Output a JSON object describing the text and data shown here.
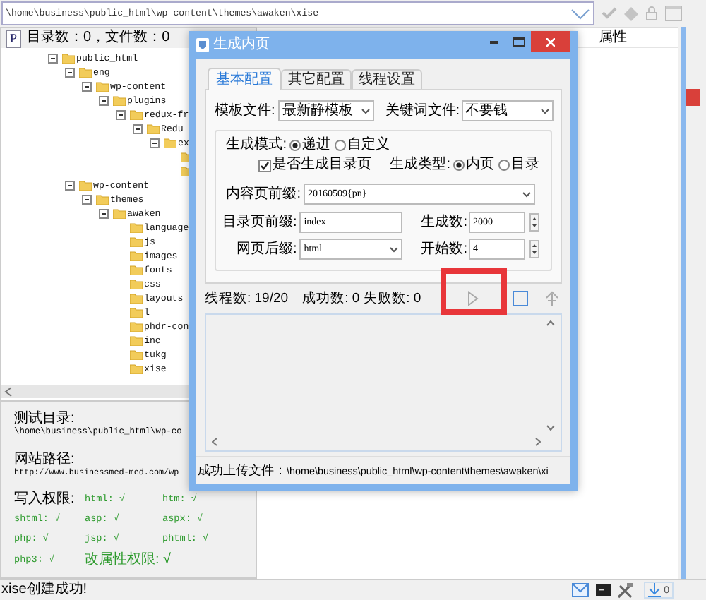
{
  "path_bar": {
    "value": "\\home\\business\\public_html\\wp-content\\themes\\awaken\\xise"
  },
  "tree_header": {
    "badge": "P",
    "label": "目录数：0，文件数：0"
  },
  "tree": [
    {
      "label": "public_html",
      "expanded": true,
      "children": [
        {
          "label": "eng",
          "expanded": true,
          "children": [
            {
              "label": "wp-content",
              "expanded": true,
              "children": [
                {
                  "label": "plugins",
                  "expanded": true,
                  "children": [
                    {
                      "label": "redux-fr",
                      "expanded": true,
                      "children": [
                        {
                          "label": "Redu",
                          "expanded": true,
                          "children": [
                            {
                              "label": "ex",
                              "expanded": true,
                              "children": [
                                {
                                  "kind": "folder"
                                },
                                {
                                  "kind": "folder"
                                }
                              ]
                            }
                          ]
                        }
                      ]
                    }
                  ]
                }
              ]
            }
          ]
        },
        {
          "label": "wp-content",
          "expanded": true,
          "children": [
            {
              "label": "themes",
              "expanded": true,
              "children": [
                {
                  "label": "awaken",
                  "expanded": true,
                  "children": [
                    {
                      "label": "language"
                    },
                    {
                      "label": "js"
                    },
                    {
                      "label": "images"
                    },
                    {
                      "label": "fonts"
                    },
                    {
                      "label": "css"
                    },
                    {
                      "label": "layouts"
                    },
                    {
                      "label": "l"
                    },
                    {
                      "label": "phdr-con"
                    },
                    {
                      "label": "inc"
                    },
                    {
                      "label": "tukg"
                    },
                    {
                      "label": "xise"
                    }
                  ]
                }
              ]
            }
          ]
        }
      ]
    }
  ],
  "column_headers": [
    {
      "label": "属性"
    }
  ],
  "info": {
    "test_dir_label": "测试目录:",
    "test_dir": "\\home\\business\\public_html\\wp-co",
    "site_path_label": "网站路径:",
    "site_path": "http://www.businessmed-med.com/wp",
    "write_label": "写入权限:",
    "permissions": [
      {
        "label": "html: √"
      },
      {
        "label": "htm: √"
      },
      {
        "label": "shtml: √"
      },
      {
        "label": "asp: √"
      },
      {
        "label": "aspx: √"
      },
      {
        "label": "php: √"
      },
      {
        "label": "jsp: √"
      },
      {
        "label": "phtml: √"
      },
      {
        "label": "php3: √"
      },
      {
        "label": "改属性权限: √"
      }
    ]
  },
  "dialog": {
    "title": "生成内页",
    "tabs": [
      {
        "label": "基本配置",
        "selected": true
      },
      {
        "label": "其它配置",
        "selected": false
      },
      {
        "label": "线程设置",
        "selected": false
      }
    ],
    "template": {
      "label": "模板文件:",
      "value": "最新静模板"
    },
    "keyword": {
      "label": "关键词文件:",
      "value": "不要钱"
    },
    "mode": {
      "label": "生成模式:",
      "options": [
        {
          "label": "递进",
          "selected": true
        },
        {
          "label": "自定义",
          "selected": false
        }
      ]
    },
    "gen_index": {
      "label": "是否生成目录页",
      "checked": true
    },
    "gen_type": {
      "label": "生成类型:",
      "options": [
        {
          "label": "内页",
          "selected": true
        },
        {
          "label": "目录",
          "selected": false
        }
      ]
    },
    "content_prefix": {
      "label": "内容页前缀:",
      "value": "20160509{pn}"
    },
    "index_prefix": {
      "label": "目录页前缀:",
      "value": "index"
    },
    "count": {
      "label": "生成数:",
      "value": "2000"
    },
    "suffix": {
      "label": "网页后缀:",
      "value": "html"
    },
    "start": {
      "label": "开始数:",
      "value": "4"
    },
    "status": {
      "threads": "线程数: 19/20",
      "success": "成功数: 0",
      "failed": "失败数: 0"
    },
    "footer": {
      "label": "成功上传文件：",
      "path": "\\home\\business\\public_html\\wp-content\\themes\\awaken\\xi"
    }
  },
  "status_bar": {
    "message": "xise创建成功!",
    "download_count": "0"
  }
}
